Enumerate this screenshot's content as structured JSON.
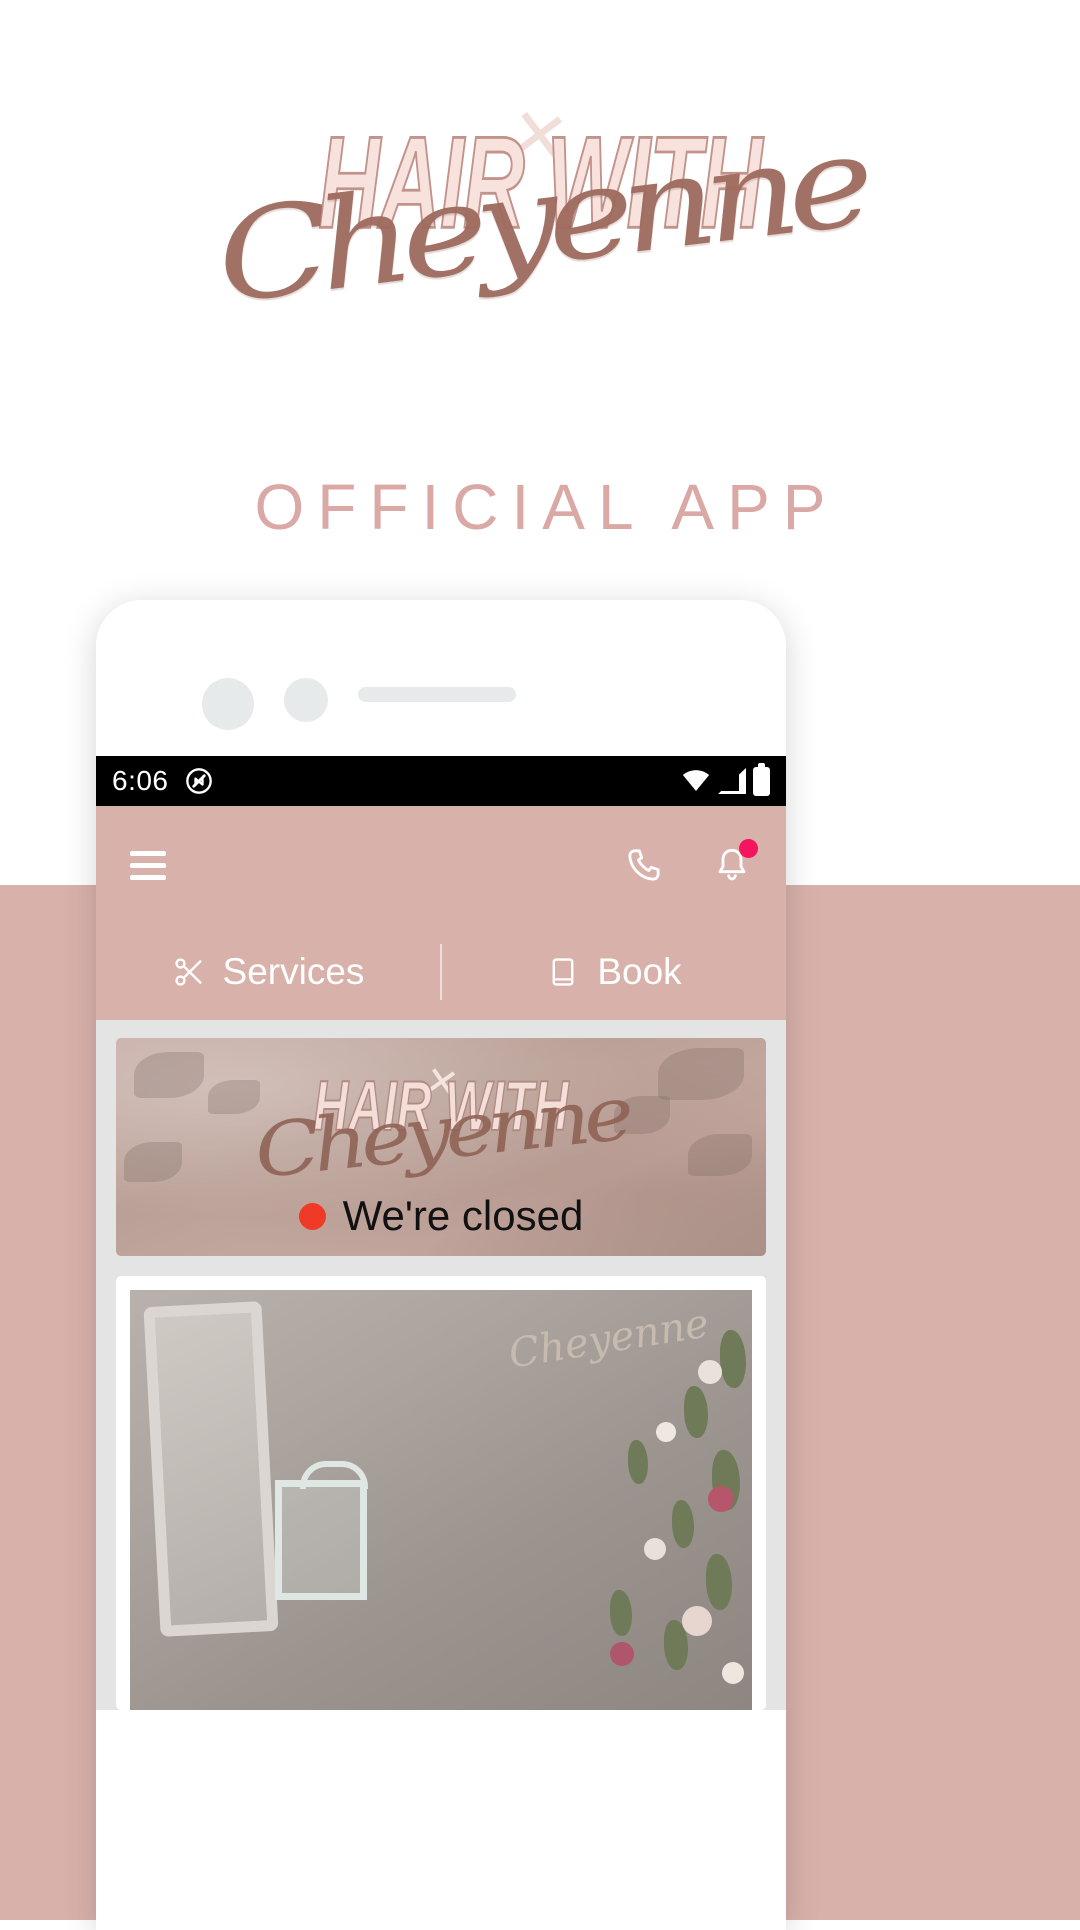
{
  "page": {
    "brand_line1": "HAIR WITH",
    "brand_script": "Cheyenne",
    "brand_x": "✕",
    "tagline": "OFFICIAL APP",
    "colors": {
      "accent_pink": "#d9b1ab",
      "tagline_pink": "#dba9a5",
      "logo_fill": "#f7e2dd",
      "logo_stroke": "#c2938b",
      "script_brown": "#9e6a5d",
      "badge_red": "#f6145e",
      "status_dot_red": "#ef3a28",
      "app_body_grey": "#e4e4e4"
    }
  },
  "phone": {
    "statusbar": {
      "time": "6:06",
      "icons": [
        "do-not-disturb-icon",
        "wifi-icon",
        "cell-signal-icon",
        "battery-icon"
      ]
    },
    "appbar": {
      "menu_icon": "hamburger-menu-icon",
      "call_icon": "phone-icon",
      "notifications_icon": "bell-icon",
      "notification_badge": true
    },
    "tabs": [
      {
        "label": "Services",
        "icon": "scissors-icon"
      },
      {
        "label": "Book",
        "icon": "book-icon"
      }
    ],
    "banner": {
      "logo_line1": "HAIR WITH",
      "logo_x": "✕",
      "logo_script": "Cheyenne",
      "status_text": "We're closed",
      "status_indicator": "closed"
    },
    "photo_card": {
      "wall_script": "Cheyenne",
      "alt": "salon-interior-photo"
    }
  }
}
